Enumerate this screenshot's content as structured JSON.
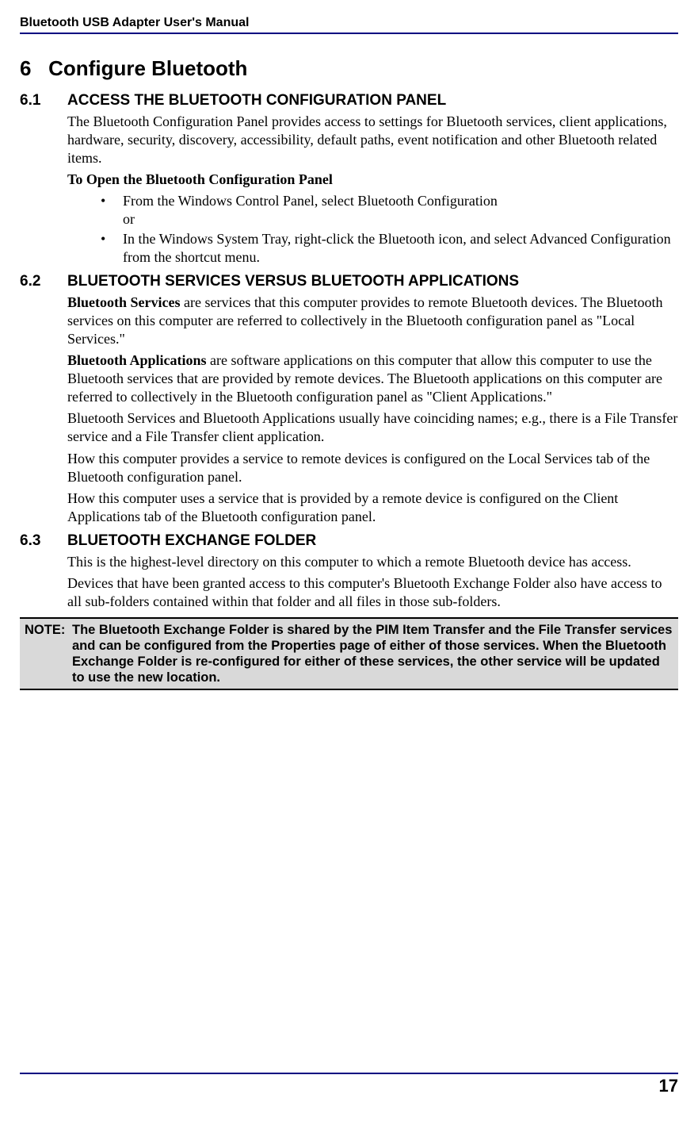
{
  "header": {
    "title": "Bluetooth USB Adapter User's Manual"
  },
  "chapter": {
    "num": "6",
    "title": "Configure Bluetooth"
  },
  "s61": {
    "num": "6.1",
    "title": "ACCESS THE BLUETOOTH CONFIGURATION PANEL",
    "p1": "The Bluetooth Configuration Panel provides access to settings for Bluetooth services, client applications, hardware, security, discovery, accessibility, default paths, event notification and other Bluetooth related items.",
    "open_heading": "To Open the Bluetooth Configuration Panel",
    "bullets": [
      "From the Windows Control Panel, select Bluetooth Configuration\nor",
      "In the Windows System Tray, right-click the Bluetooth icon, and select Advanced Configuration from the shortcut menu."
    ]
  },
  "s62": {
    "num": "6.2",
    "title": "BLUETOOTH SERVICES VERSUS BLUETOOTH APPLICATIONS",
    "p1_bold": "Bluetooth Services",
    "p1_rest": " are services that this computer provides to remote Bluetooth devices. The Bluetooth services on this computer are referred to collectively in the Bluetooth configuration panel as \"Local Services.\"",
    "p2_bold": "Bluetooth Applications",
    "p2_rest": " are software applications on this computer that allow this computer to use the Bluetooth services that are provided by remote devices. The Bluetooth applications on this computer are referred to collectively in the Bluetooth configuration panel as \"Client Applications.\"",
    "p3": "Bluetooth Services and Bluetooth Applications usually have coinciding names; e.g., there is a File Transfer service and a File Transfer client application.",
    "p4": "How this computer provides a service to remote devices is configured on the Local Services tab of the Bluetooth configuration panel.",
    "p5": "How this computer uses a service that is provided by a remote device is configured on the Client Applications tab of the Bluetooth configuration panel."
  },
  "s63": {
    "num": "6.3",
    "title": "BLUETOOTH EXCHANGE FOLDER",
    "p1": "This is the highest-level directory on this computer to which a remote Bluetooth device has access.",
    "p2": "Devices that have been granted access to this computer's Bluetooth Exchange Folder also have access to all sub-folders contained within that folder and all files in those sub-folders."
  },
  "note": {
    "label": "NOTE:",
    "text": "The Bluetooth Exchange Folder is shared by the PIM Item Transfer and the File Transfer services and can be configured from the Properties page of either of those services. When the Bluetooth Exchange Folder is re-configured for either of these services, the other service will be updated to use the new location."
  },
  "footer": {
    "page": "17"
  }
}
